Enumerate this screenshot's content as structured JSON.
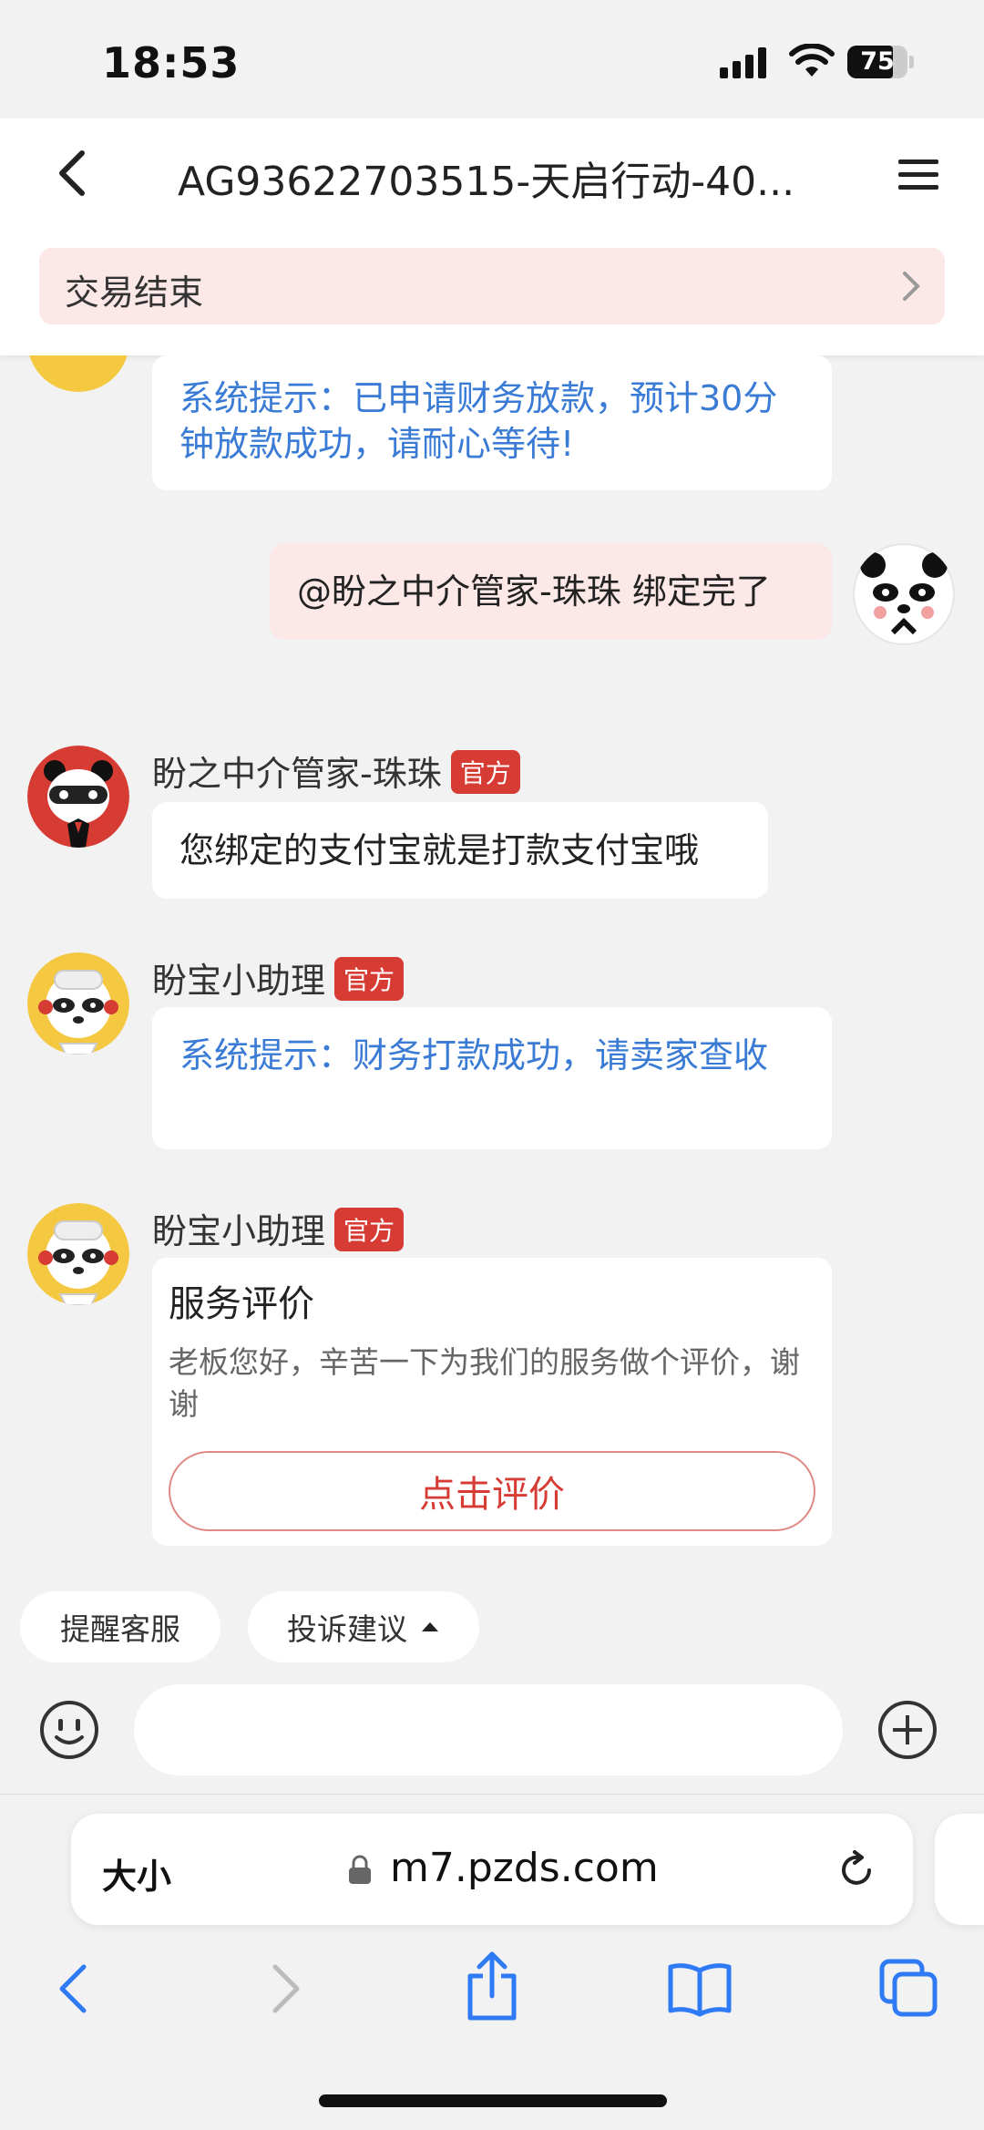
{
  "status_bar": {
    "time": "18:53",
    "battery": "75"
  },
  "header": {
    "title": "AG93622703515-天启行动-40...",
    "status_banner": "交易结束"
  },
  "messages": [
    {
      "type": "system",
      "text": "系统提示：已申请财务放款，预计30分钟放款成功，请耐心等待!"
    },
    {
      "type": "self",
      "text": "@盼之中介管家-珠珠 绑定完了"
    },
    {
      "type": "agent",
      "sender": "盼之中介管家-珠珠",
      "badge": "官方",
      "text": "您绑定的支付宝就是打款支付宝哦"
    },
    {
      "type": "system",
      "sender": "盼宝小助理",
      "badge": "官方",
      "text": "系统提示：财务打款成功，请卖家查收"
    },
    {
      "type": "card",
      "sender": "盼宝小助理",
      "badge": "官方",
      "card_title": "服务评价",
      "card_body": "老板您好，辛苦一下为我们的服务做个评价，谢谢",
      "card_button": "点击评价"
    }
  ],
  "quick_actions": {
    "remind": "提醒客服",
    "complaint": "投诉建议"
  },
  "composer": {
    "placeholder": ""
  },
  "browser": {
    "text_size": "大小",
    "url": "m7.pzds.com"
  },
  "colors": {
    "accent_red": "#d63b34",
    "system_blue": "#3a7bd5",
    "self_bubble": "#fbe8e7"
  }
}
